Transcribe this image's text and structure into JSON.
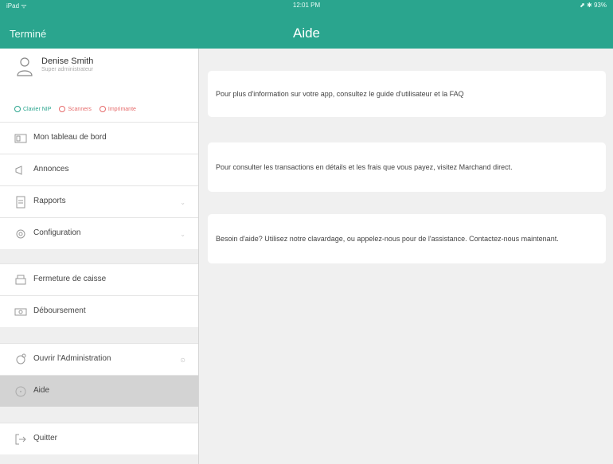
{
  "status": {
    "left": "iPad ᯤ",
    "time": "12:01 PM",
    "right": "⬈ ✱ 93%"
  },
  "header": {
    "done": "Terminé",
    "title": "Aide"
  },
  "user": {
    "name": "Denise Smith",
    "role": "Super administrateur"
  },
  "actions": [
    {
      "label": "Clavier NIP",
      "color": "#2aa58e"
    },
    {
      "label": "Scanners",
      "color": "#e66b6b"
    },
    {
      "label": "Imprimante",
      "color": "#e66b6b"
    }
  ],
  "menu": [
    {
      "label": "Mon tableau de bord",
      "icon": "dashboard-icon"
    },
    {
      "label": "Annonces",
      "icon": "megaphone-icon"
    },
    {
      "label": "Rapports",
      "icon": "document-icon",
      "chevron": "⌄"
    },
    {
      "label": "Configuration",
      "icon": "settings-icon",
      "chevron": "⌄"
    },
    {
      "label": "Fermeture de caisse",
      "icon": "cash-register-icon"
    },
    {
      "label": "Déboursement",
      "icon": "money-icon"
    },
    {
      "label": "Ouvrir l'Administration",
      "icon": "admin-icon",
      "chevron": "⊙"
    },
    {
      "label": "Aide",
      "icon": "help-icon"
    },
    {
      "label": "Quitter",
      "icon": "logout-icon"
    }
  ],
  "cards": [
    {
      "text": "Pour plus d'information sur votre app, consultez le guide d'utilisateur et la FAQ"
    },
    {
      "text": "Pour consulter les transactions en détails et les frais que vous payez, visitez Marchand direct."
    },
    {
      "text": "Besoin d'aide? Utilisez notre clavardage, ou appelez-nous pour de l'assistance. Contactez-nous maintenant."
    }
  ]
}
